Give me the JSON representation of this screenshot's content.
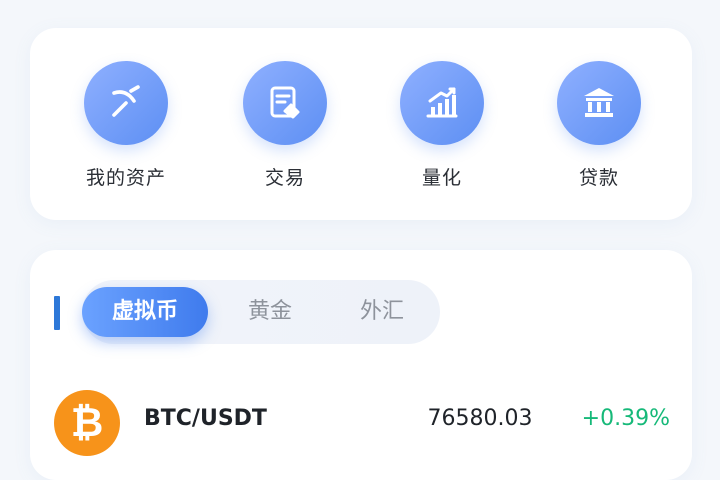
{
  "colors": {
    "accent": "#3f7bed",
    "indicator": "#2d78d8",
    "positive": "#16b979",
    "bitcoin": "#f7931a"
  },
  "actions": [
    {
      "label": "我的资产",
      "icon": "pickaxe-icon"
    },
    {
      "label": "交易",
      "icon": "document-handshake-icon"
    },
    {
      "label": "量化",
      "icon": "bar-chart-trend-icon"
    },
    {
      "label": "贷款",
      "icon": "bank-icon"
    }
  ],
  "tabs": [
    {
      "label": "虚拟币",
      "active": true
    },
    {
      "label": "黄金",
      "active": false
    },
    {
      "label": "外汇",
      "active": false
    }
  ],
  "market": [
    {
      "pair": "BTC/USDT",
      "price": "76580.03",
      "change": "+0.39%",
      "icon": "bitcoin-icon"
    }
  ]
}
